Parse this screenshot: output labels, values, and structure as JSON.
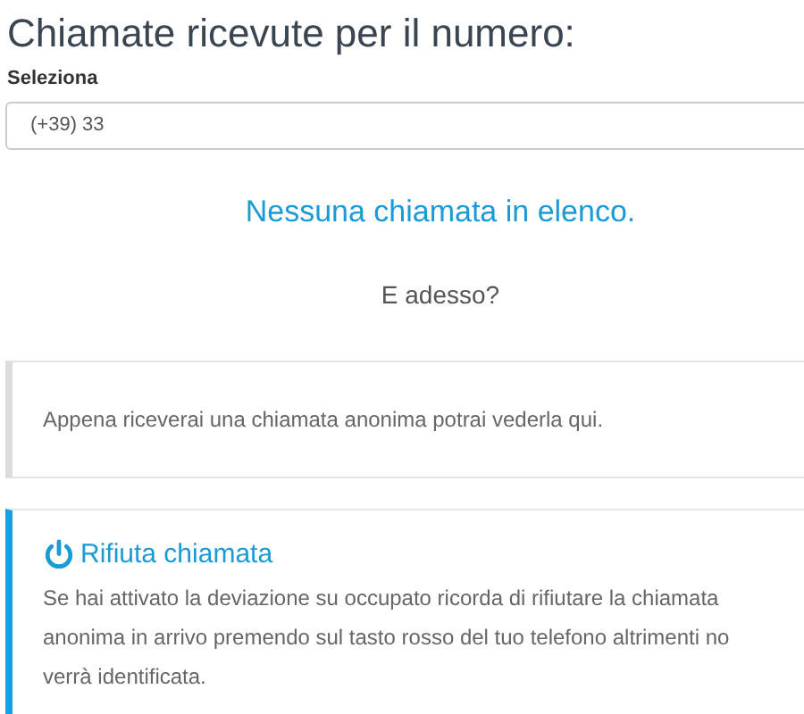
{
  "title": "Chiamate ricevute per il numero:",
  "select": {
    "label": "Seleziona",
    "value": "(+39) 33"
  },
  "empty_message": "Nessuna chiamata in elenco.",
  "question": "E adesso?",
  "info_box": {
    "text": "Appena riceverai una chiamata anonima potrai vederla qui."
  },
  "tip_box": {
    "title": "Rifiuta chiamata",
    "text_lines": [
      "Se hai attivato la deviazione su occupato ricorda di rifiutare la chiamata",
      "anonima in arrivo premendo sul tasto rosso del tuo telefono altrimenti no",
      "verrà identificata."
    ]
  }
}
